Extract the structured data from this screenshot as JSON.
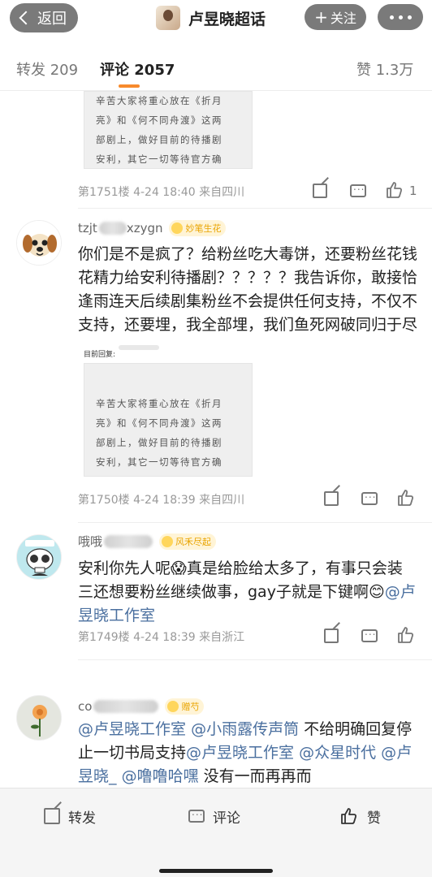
{
  "header": {
    "back_label": "返回",
    "title": "卢昱晓超话",
    "follow_label": "关注"
  },
  "tabs": [
    {
      "label": "转发 209",
      "active": false
    },
    {
      "label": "评论 2057",
      "active": true
    },
    {
      "label": "赞 1.3万",
      "active": false
    }
  ],
  "reply_image_text": [
    "辛苦大家将重心放在《折月",
    "亮》和《何不同舟渡》这两",
    "部剧上，做好目前的待播剧",
    "安利，其它一切等待官方确"
  ],
  "comments": [
    {
      "meta": "第1751楼 4-24 18:40 来自四川",
      "like_count": "1"
    },
    {
      "username": "tzjt",
      "username_tail": "xzygn",
      "badge": "妙笔生花",
      "text": "你们是不是疯了？给粉丝吃大毒饼，还要粉丝花钱花精力给安利待播剧？？？？？我告诉你，敢接恰逢雨连天后续剧集粉丝不会提供任何支持，不仅不支持，还要埋，我全部埋，我们鱼死网破同归于尽",
      "reply_label": "目前回复:",
      "meta": "第1750楼 4-24 18:39 来自四川"
    },
    {
      "username": "哦哦",
      "badge": "风禾尽起",
      "text_parts": [
        "安利你先人呢",
        "😱",
        "真是给脸给太多了，有事只会装三还想要粉丝继续做事，gay子就是下键啊",
        "😊"
      ],
      "mention": "@卢昱晓工作室",
      "meta": "第1749楼 4-24 18:39 来自浙江"
    },
    {
      "username": "co",
      "badge": "赠芍",
      "segments": [
        {
          "t": "@卢昱晓工作室",
          "m": true
        },
        {
          "t": " ",
          "m": false
        },
        {
          "t": "@小雨露传声筒",
          "m": true
        },
        {
          "t": " 不给明确回复停止一切书局支持",
          "m": false
        },
        {
          "t": "@卢昱晓工作室",
          "m": true
        },
        {
          "t": " ",
          "m": false
        },
        {
          "t": "@众星时代",
          "m": true
        },
        {
          "t": " ",
          "m": false
        },
        {
          "t": "@卢昱晓_",
          "m": true
        },
        {
          "t": " ",
          "m": false
        },
        {
          "t": "@噜噜哈嘿",
          "m": true
        },
        {
          "t": " 没有一而再再而",
          "m": false
        }
      ]
    }
  ],
  "bottom_bar": {
    "repost_label": "转发",
    "comment_label": "评论",
    "like_label": "赞"
  },
  "colors": {
    "accent": "#f78a2c",
    "mention": "#4a6f9f",
    "header_button": "#7a7a7a",
    "badge_text": "#e9a400"
  }
}
